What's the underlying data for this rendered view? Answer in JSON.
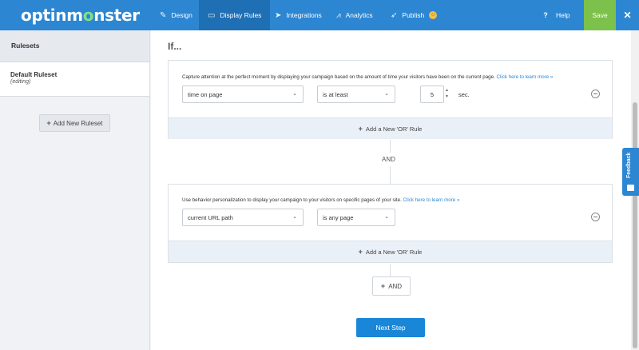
{
  "header": {
    "logo_pre": "optinm",
    "logo_o": "o",
    "logo_post": "nster",
    "nav": [
      {
        "label": "Design",
        "icon": "pencil-icon"
      },
      {
        "label": "Display Rules",
        "icon": "monitor-icon"
      },
      {
        "label": "Integrations",
        "icon": "paper-plane-icon"
      },
      {
        "label": "Analytics",
        "icon": "chart-icon"
      },
      {
        "label": "Publish",
        "icon": "rocket-icon"
      }
    ],
    "help_label": "Help",
    "save_label": "Save"
  },
  "sidebar": {
    "heading": "Rulesets",
    "items": [
      {
        "title": "Default Ruleset",
        "status": "(editing)"
      }
    ],
    "add_label": "Add New Ruleset"
  },
  "main": {
    "if_label": "If...",
    "rules": [
      {
        "description": "Capture attention at the perfect moment by displaying your campaign based on the amount of time your visitors have been on the current page.",
        "link": "Click here to learn more »",
        "condition": "time on page",
        "operator": "is at least",
        "value": "5",
        "unit": "sec.",
        "or_label": "Add a New 'OR' Rule"
      },
      {
        "description": "Use behavior personalization to display your campaign to your visitors on specific pages of your site.",
        "link": "Click here to learn more »",
        "condition": "current URL path",
        "operator": "is any page",
        "or_label": "Add a New 'OR' Rule"
      }
    ],
    "and_label": "AND",
    "and_button": "AND",
    "next_label": "Next Step"
  },
  "feedback_label": "Feedback"
}
